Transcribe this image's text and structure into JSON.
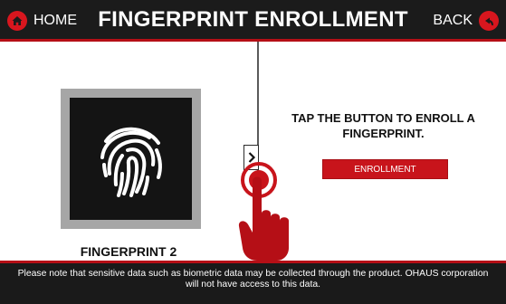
{
  "header": {
    "home_label": "HOME",
    "title": "FINGERPRINT ENROLLMENT",
    "back_label": "BACK",
    "home_icon": "home-icon",
    "back_icon": "back-arrow-icon"
  },
  "left_panel": {
    "fingerprint_label": "FINGERPRINT 2",
    "icon": "fingerprint-icon"
  },
  "right_panel": {
    "instruction_line1": "TAP THE BUTTON TO ENROLL A",
    "instruction_line2": "FINGERPRINT.",
    "enroll_button_label": "ENROLLMENT"
  },
  "expand_tab": {
    "icon": "chevron-right-icon",
    "glyph": ">"
  },
  "hand_hint": {
    "icon": "tap-hand-icon"
  },
  "footer": {
    "line1": "Please note that sensitive data such as biometric data may be collected through the product. OHAUS corporation",
    "line2": "will not have access to this data."
  },
  "colors": {
    "accent_red": "#c8141b",
    "header_bg": "#1b1b1b",
    "panel_bg": "#ffffff",
    "frame_gray": "#a6a6a6"
  }
}
